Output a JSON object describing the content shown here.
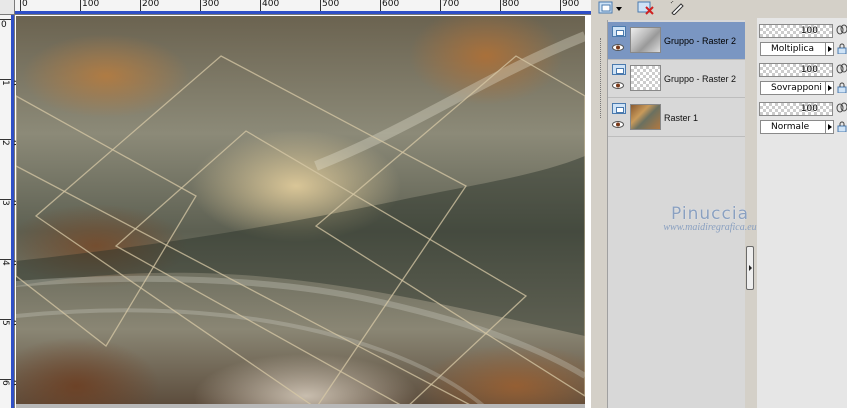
{
  "ruler_h_labels": [
    "0",
    "100",
    "200",
    "300",
    "400",
    "500",
    "600",
    "700",
    "800",
    "900"
  ],
  "ruler_v_labels": [
    "0",
    "1 0 0",
    "2 0 0",
    "3 0 0",
    "4 0 0",
    "5 0 0",
    "6 0"
  ],
  "layers": [
    {
      "name": "Gruppo - Raster 2",
      "selected": true,
      "visible": true,
      "opacity": "100",
      "blend_mode": "Moltiplica"
    },
    {
      "name": "Gruppo - Raster 2",
      "selected": false,
      "visible": true,
      "opacity": "100",
      "blend_mode": "Sovrapponi"
    },
    {
      "name": "Raster 1",
      "selected": false,
      "visible": true,
      "opacity": "100",
      "blend_mode": "Normale"
    }
  ],
  "watermark": {
    "name": "Pinuccia",
    "url": "www.maidiregrafica.eu"
  },
  "colors": {
    "ruler_accent": "#2f4fc6",
    "selected_layer": "#7a96c2",
    "watermark": "#8aa0c0"
  }
}
